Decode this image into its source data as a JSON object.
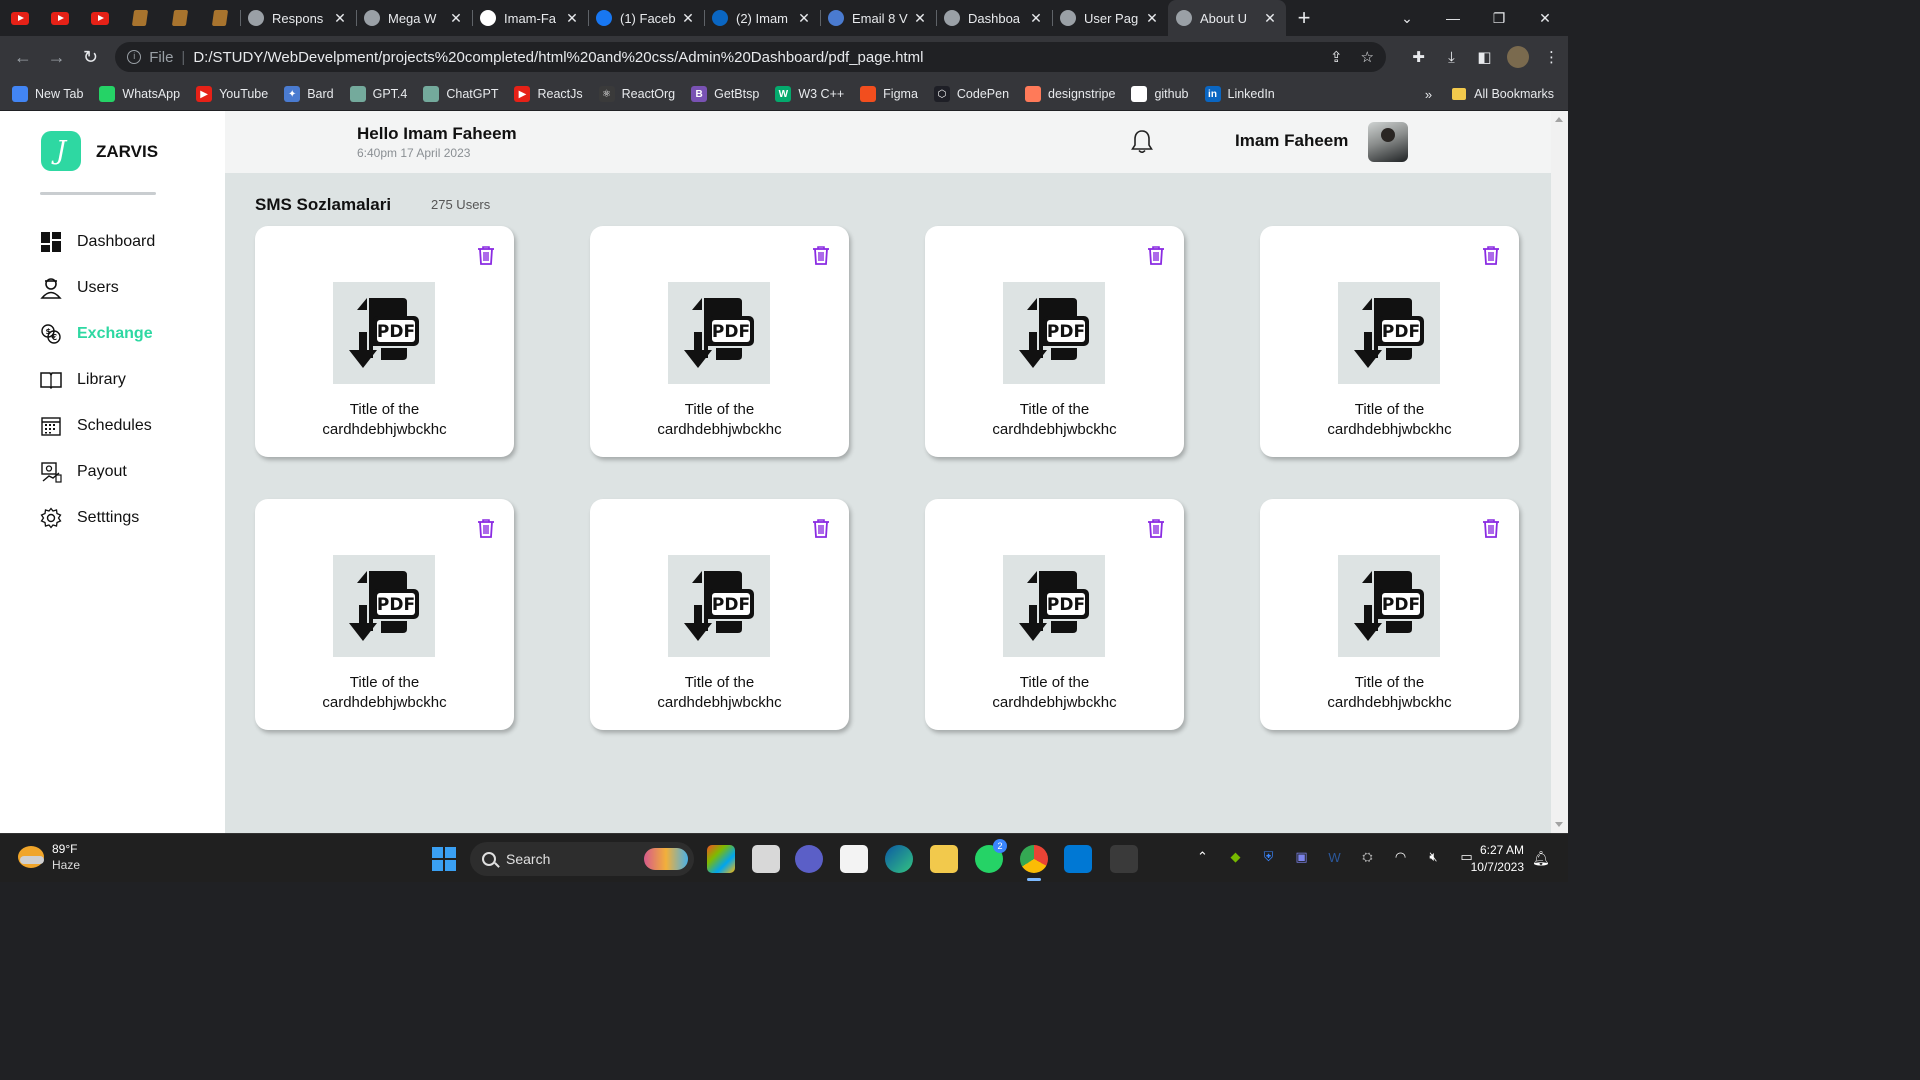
{
  "browser": {
    "pinned_tabs": [
      "youtube",
      "youtube",
      "youtube",
      "blogger",
      "blogger",
      "blogger"
    ],
    "tabs": [
      {
        "title": "Respons",
        "icon": "chatgpt-icon",
        "color": "#9aa0a6"
      },
      {
        "title": "Mega W",
        "icon": "globe-icon",
        "color": "#9aa0a6"
      },
      {
        "title": "Imam-Fa",
        "icon": "github-icon",
        "color": "#ffffff"
      },
      {
        "title": "(1) Faceb",
        "icon": "facebook-icon",
        "color": "#1877f2"
      },
      {
        "title": "(2) Imam",
        "icon": "linkedin-icon",
        "color": "#0a66c2"
      },
      {
        "title": "Email 8 V",
        "icon": "email-icon",
        "color": "#4a7bd0"
      },
      {
        "title": "Dashboa",
        "icon": "globe-icon",
        "color": "#9aa0a6"
      },
      {
        "title": "User Pag",
        "icon": "globe-icon",
        "color": "#9aa0a6"
      },
      {
        "title": "About U",
        "icon": "globe-icon",
        "color": "#9aa0a6",
        "active": true
      }
    ],
    "new_tab": "+",
    "window_controls": {
      "tab_search": "⌄",
      "minimize": "—",
      "restore": "❐",
      "close": "✕"
    },
    "address": {
      "scheme": "File",
      "url": "D:/STUDY/WebDevelpment/projects%20completed/html%20and%20css/Admin%20Dashboard/pdf_page.html"
    },
    "bookmarks": [
      {
        "label": "New Tab",
        "color": "#4285f4",
        "glyph": ""
      },
      {
        "label": "WhatsApp",
        "color": "#25d366",
        "glyph": ""
      },
      {
        "label": "YouTube",
        "color": "#e62117",
        "glyph": "▶"
      },
      {
        "label": "Bard",
        "color": "#4a7bd0",
        "glyph": "✦"
      },
      {
        "label": "GPT.4",
        "color": "#74aa9c",
        "glyph": ""
      },
      {
        "label": "ChatGPT",
        "color": "#74aa9c",
        "glyph": ""
      },
      {
        "label": "ReactJs",
        "color": "#e62117",
        "glyph": "▶"
      },
      {
        "label": "ReactOrg",
        "color": "#3a3a3a",
        "glyph": "⚛"
      },
      {
        "label": "GetBtsp",
        "color": "#7952b3",
        "glyph": "B"
      },
      {
        "label": "W3 C++",
        "color": "#04aa6d",
        "glyph": "W"
      },
      {
        "label": "Figma",
        "color": "#f24e1e",
        "glyph": ""
      },
      {
        "label": "CodePen",
        "color": "#1e1f26",
        "glyph": "⬡"
      },
      {
        "label": "designstripe",
        "color": "#ff7a59",
        "glyph": ""
      },
      {
        "label": "github",
        "color": "#ffffff",
        "glyph": ""
      },
      {
        "label": "LinkedIn",
        "color": "#0a66c2",
        "glyph": "in"
      }
    ],
    "bookmarks_more": "»",
    "all_bookmarks": "All Bookmarks"
  },
  "app": {
    "brand": "ZARVIS",
    "logo_glyph": "J",
    "accent": "#2ed8a2",
    "nav": [
      {
        "label": "Dashboard",
        "icon": "dashboard-icon"
      },
      {
        "label": "Users",
        "icon": "user-icon"
      },
      {
        "label": "Exchange",
        "icon": "exchange-icon",
        "active": true
      },
      {
        "label": "Library",
        "icon": "book-icon"
      },
      {
        "label": "Schedules",
        "icon": "calendar-icon"
      },
      {
        "label": "Payout",
        "icon": "payout-icon"
      },
      {
        "label": "Setttings",
        "icon": "gear-icon"
      }
    ],
    "header": {
      "greeting": "Hello Imam Faheem",
      "datetime": "6:40pm 17 April 2023",
      "user_name": "Imam Faheem"
    },
    "section": {
      "title": "SMS Sozlamalari",
      "count": "275 Users"
    },
    "trash_color": "#8a2be2",
    "cards": [
      {
        "title": "Title of the cardhdebhjwbckhc"
      },
      {
        "title": "Title of the cardhdebhjwbckhc"
      },
      {
        "title": "Title of the cardhdebhjwbckhc"
      },
      {
        "title": "Title of the cardhdebhjwbckhc"
      },
      {
        "title": "Title of the cardhdebhjwbckhc"
      },
      {
        "title": "Title of the cardhdebhjwbckhc"
      },
      {
        "title": "Title of the cardhdebhjwbckhc"
      },
      {
        "title": "Title of the cardhdebhjwbckhc"
      }
    ]
  },
  "taskbar": {
    "weather": {
      "temp": "89°F",
      "condition": "Haze"
    },
    "search_placeholder": "Search",
    "time": "6:27 AM",
    "date": "10/7/2023",
    "whatsapp_badge": "2"
  }
}
